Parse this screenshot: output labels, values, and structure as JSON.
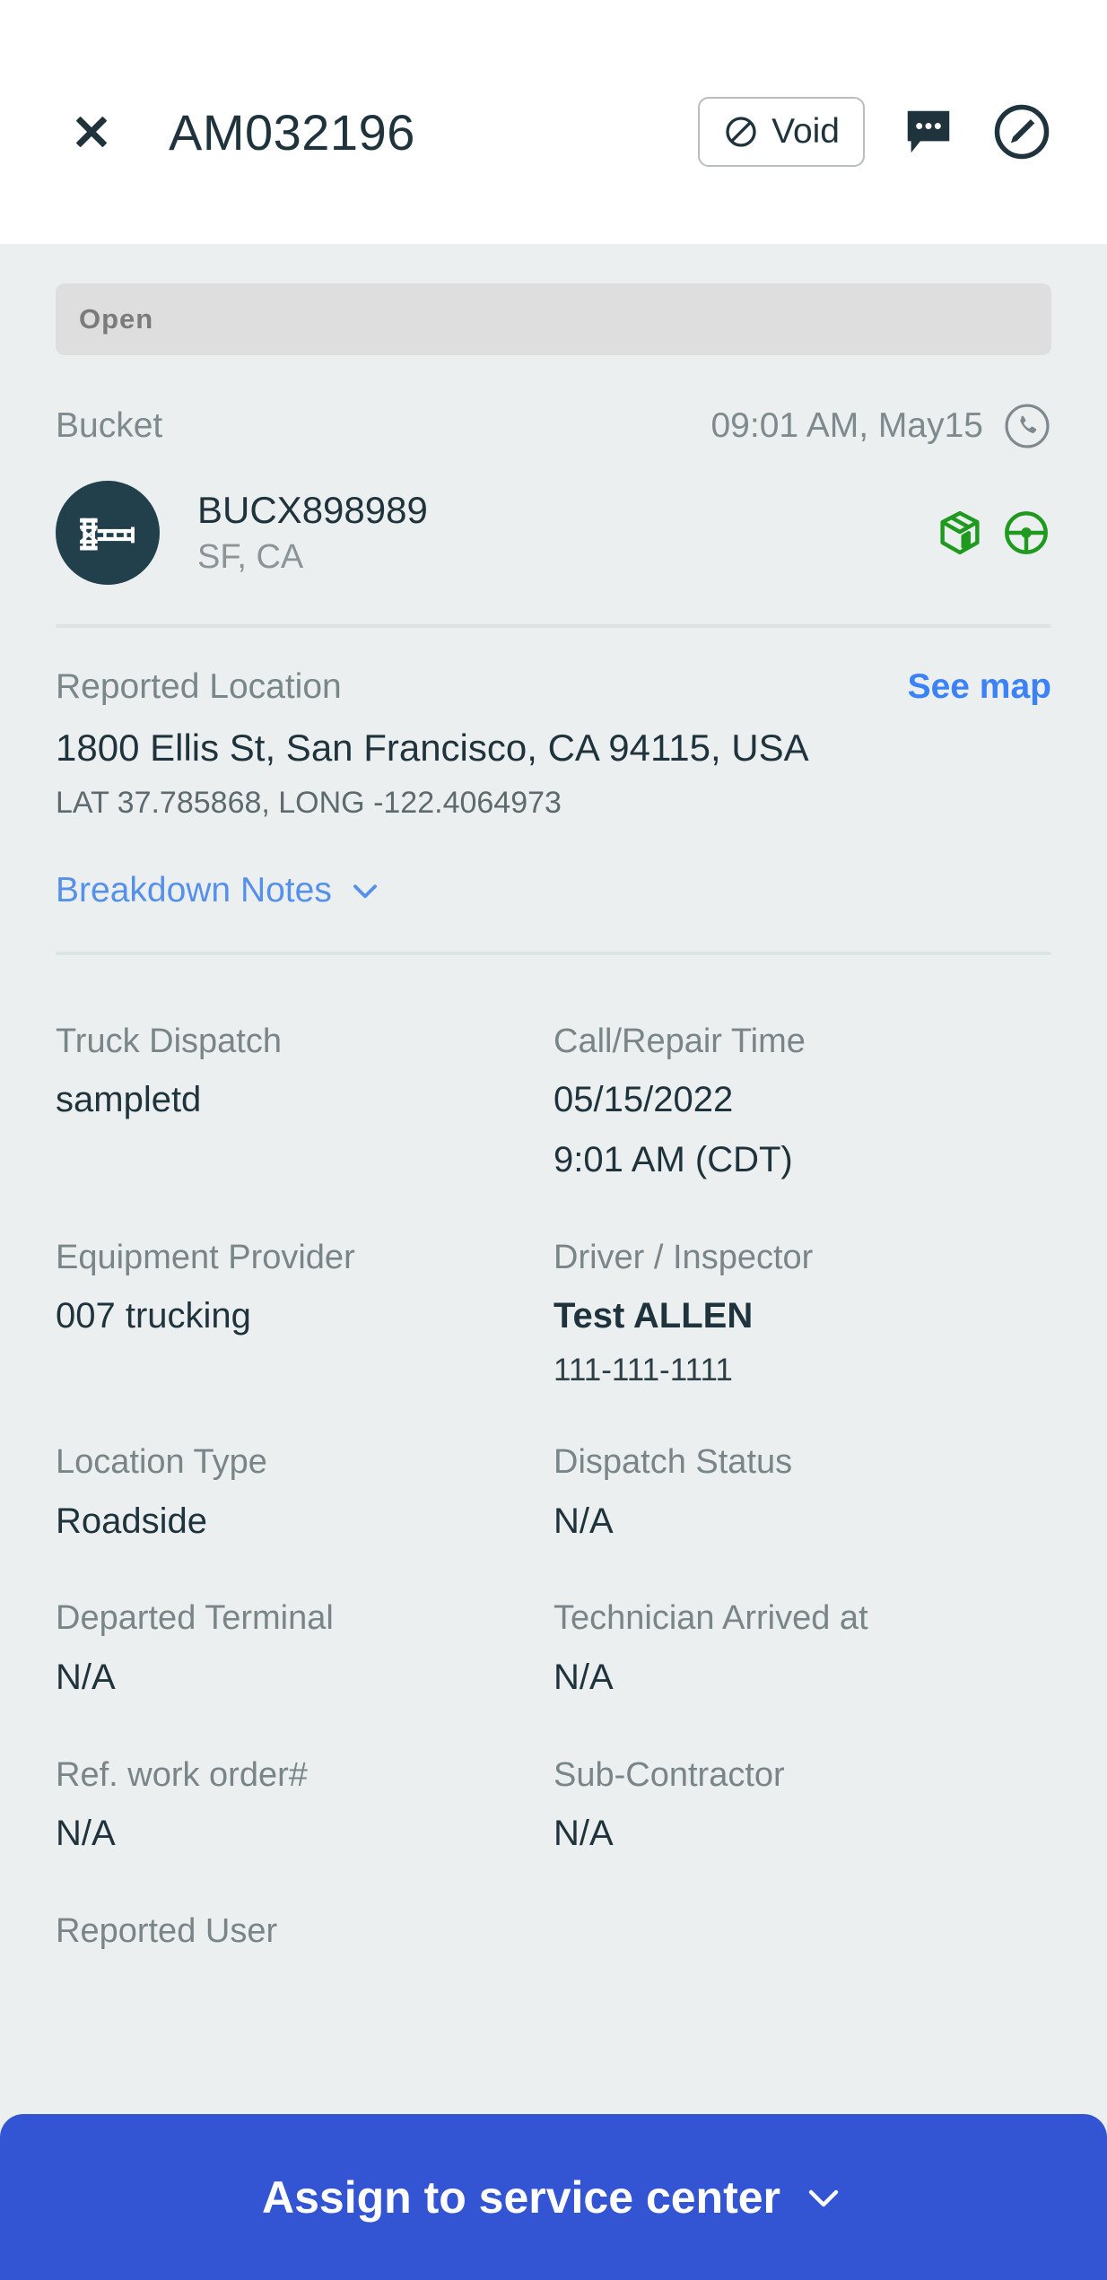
{
  "header": {
    "close_icon": "close-icon",
    "title": "AM032196",
    "void_label": "Void",
    "void_icon": "block-icon",
    "chat_icon": "chat-bubble-icon",
    "edit_icon": "edit-pencil-circle-icon"
  },
  "status": {
    "label": "Open"
  },
  "bucket": {
    "label": "Bucket",
    "time": "09:01 AM, May15",
    "phone_icon": "phone-circle-icon",
    "equipment_id": "BUCX898989",
    "equipment_location": "SF, CA",
    "avatar_icon": "chassis-icon",
    "badge_icons": [
      "package-box-icon",
      "steering-wheel-icon"
    ]
  },
  "reported_location": {
    "label": "Reported Location",
    "see_map": "See map",
    "address": "1800 Ellis St, San Francisco, CA 94115, USA",
    "coords": "LAT 37.785868, LONG -122.4064973"
  },
  "breakdown_notes": {
    "label": "Breakdown Notes",
    "chevron_icon": "chevron-down-icon"
  },
  "fields": [
    {
      "label": "Truck Dispatch",
      "value": "sampletd"
    },
    {
      "label": "Call/Repair Time",
      "value": "05/15/2022",
      "value2": "9:01 AM (CDT)"
    },
    {
      "label": "Equipment Provider",
      "value": "007 trucking"
    },
    {
      "label": "Driver / Inspector",
      "value": "Test ALLEN",
      "bold": true,
      "sub": "111-111-1111"
    },
    {
      "label": "Location Type",
      "value": "Roadside"
    },
    {
      "label": "Dispatch Status",
      "value": "N/A"
    },
    {
      "label": "Departed Terminal",
      "value": "N/A"
    },
    {
      "label": "Technician Arrived at",
      "value": "N/A"
    },
    {
      "label": "Ref. work order#",
      "value": "N/A"
    },
    {
      "label": "Sub-Contractor",
      "value": "N/A"
    },
    {
      "label": "Reported User",
      "value": ""
    }
  ],
  "bottom_bar": {
    "label": "Assign to service center",
    "chevron_icon": "chevron-down-icon"
  },
  "colors": {
    "accent_blue": "#3355d4",
    "link_blue": "#3b82f6",
    "dark_navy": "#1f333d",
    "badge_green": "#1f9a1f",
    "page_bg": "#eceff0"
  }
}
